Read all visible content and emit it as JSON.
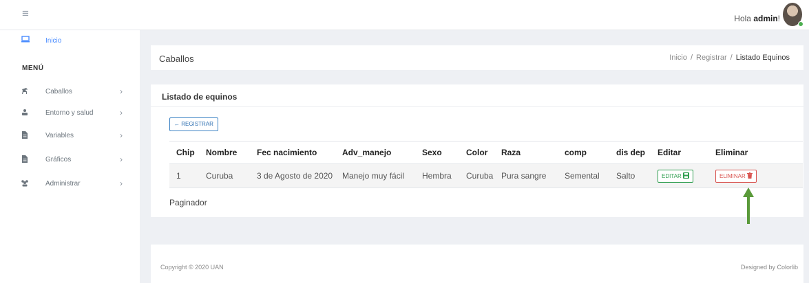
{
  "topbar": {
    "greeting_prefix": "Hola ",
    "user": "admin",
    "greeting_suffix": "!"
  },
  "sidebar": {
    "home_label": "Inicio",
    "menu_heading": "MENÚ",
    "items": [
      {
        "label": "Caballos",
        "icon": "horse-icon"
      },
      {
        "label": "Entorno y salud",
        "icon": "people-icon"
      },
      {
        "label": "Variables",
        "icon": "file-icon"
      },
      {
        "label": "Gráficos",
        "icon": "file-icon"
      },
      {
        "label": "Administrar",
        "icon": "users-icon"
      }
    ]
  },
  "page_header": {
    "title": "Caballos",
    "breadcrumb": [
      "Inicio",
      "Registrar",
      "Listado Equinos"
    ]
  },
  "list": {
    "title": "Listado de equinos",
    "register_label": "← REGISTRAR",
    "columns": [
      "Chip",
      "Nombre",
      "Fec nacimiento",
      "Adv_manejo",
      "Sexo",
      "Color",
      "Raza",
      "comp",
      "dis dep",
      "Editar",
      "Eliminar"
    ],
    "rows": [
      [
        "1",
        "Curuba",
        "3 de Agosto de 2020",
        "Manejo muy fácil",
        "Hembra",
        "Curuba",
        "Pura sangre",
        "Semental",
        "Salto"
      ]
    ],
    "edit_label": "EDITAR",
    "delete_label": "ELIMINAR",
    "paginator": "Paginador"
  },
  "footer": {
    "copyright": "Copyright © 2020 UAN",
    "designed": "Designed by Colorlib"
  },
  "colors": {
    "accent": "#4a8cff",
    "edit": "#2e9e4f",
    "delete": "#d9534f",
    "arrow": "#5a9a3a"
  }
}
